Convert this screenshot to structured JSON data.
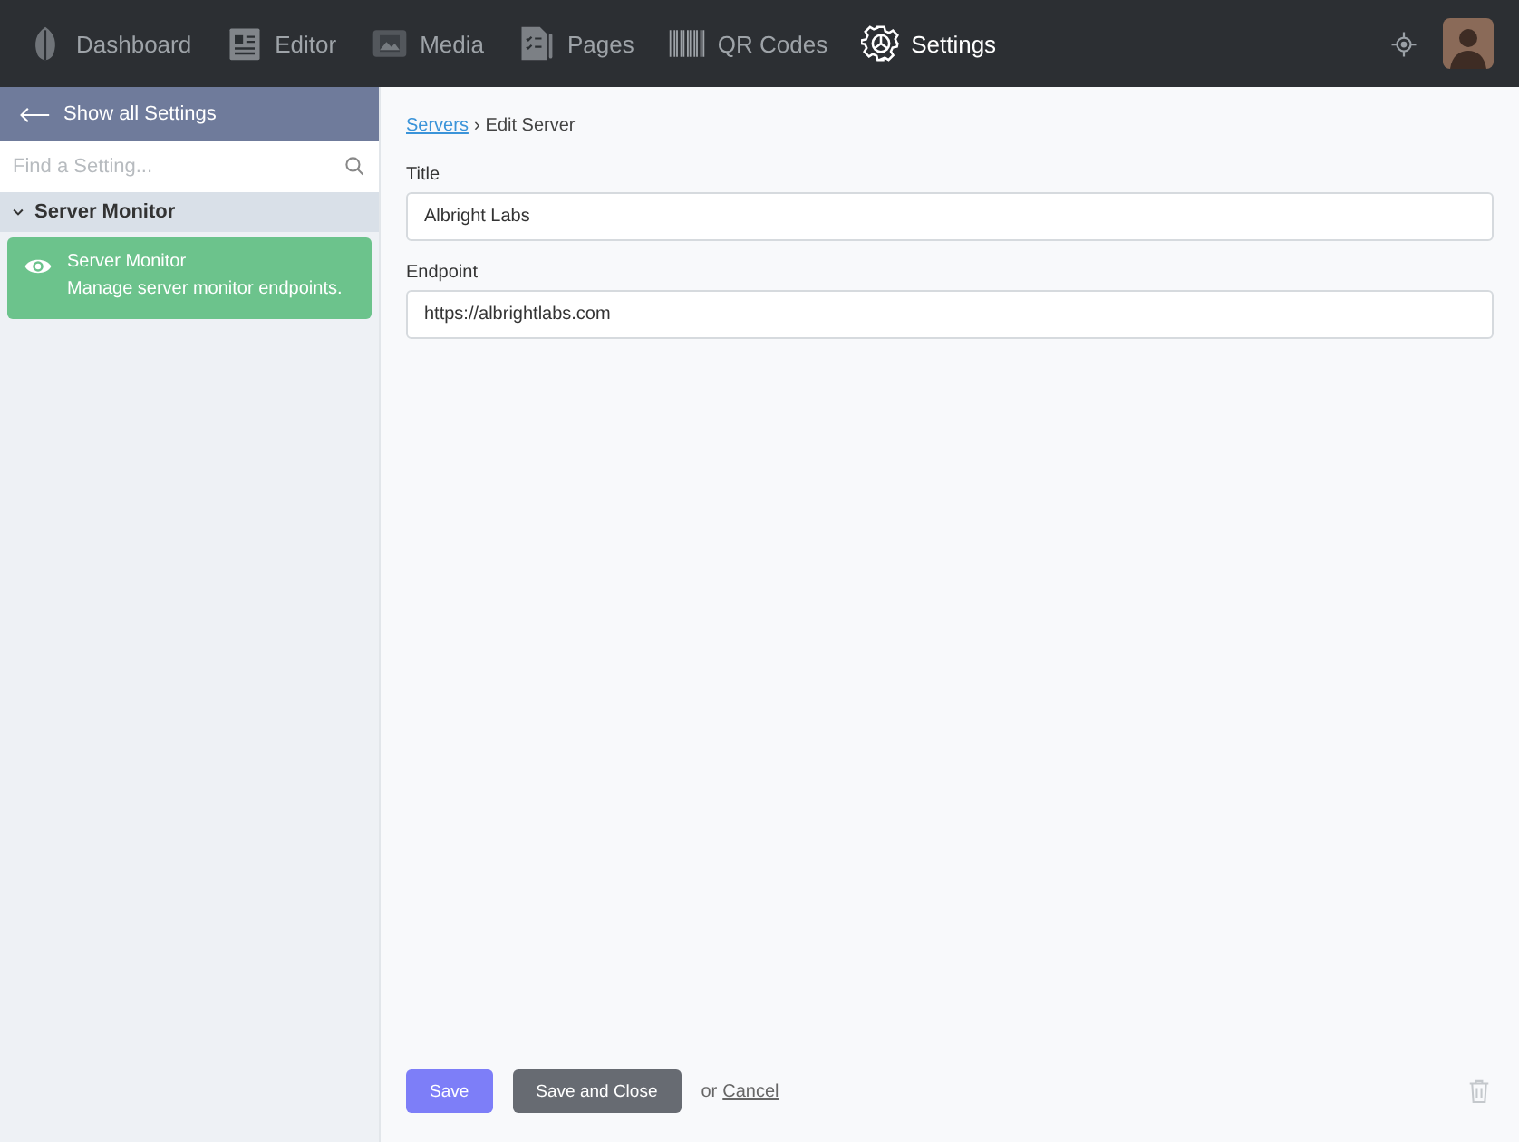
{
  "nav": [
    {
      "label": "Dashboard",
      "selected": false
    },
    {
      "label": "Editor",
      "selected": false
    },
    {
      "label": "Media",
      "selected": false
    },
    {
      "label": "Pages",
      "selected": false
    },
    {
      "label": "QR Codes",
      "selected": false
    },
    {
      "label": "Settings",
      "selected": true
    }
  ],
  "sidebar": {
    "back_link": "Show all Settings",
    "search": {
      "placeholder": "Find a Setting..."
    },
    "group": {
      "label": "Server Monitor",
      "expanded": true,
      "items": [
        {
          "title": "Server Monitor",
          "description": "Manage server monitor endpoints.",
          "selected": true
        }
      ]
    }
  },
  "breadcrumb": {
    "link": "Servers",
    "separator": "›",
    "current": "Edit Server"
  },
  "fields": [
    {
      "label": "Title",
      "value": "Albright Labs"
    },
    {
      "label": "Endpoint",
      "value": "https://albrightlabs.com"
    }
  ],
  "actions": {
    "save": "Save",
    "save_close": "Save and Close",
    "or": "or",
    "cancel": "Cancel"
  }
}
